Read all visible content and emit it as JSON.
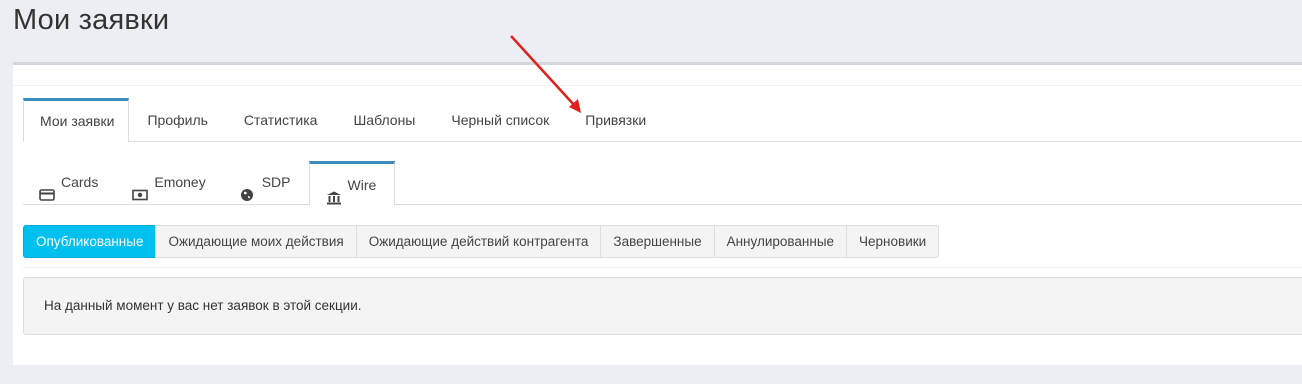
{
  "page": {
    "title": "Мои заявки"
  },
  "main_tabs": [
    {
      "label": "Мои заявки",
      "active": true
    },
    {
      "label": "Профиль",
      "active": false
    },
    {
      "label": "Статистика",
      "active": false
    },
    {
      "label": "Шаблоны",
      "active": false
    },
    {
      "label": "Черный список",
      "active": false
    },
    {
      "label": "Привязки",
      "active": false
    }
  ],
  "sub_tabs": [
    {
      "label": "Cards",
      "icon": "credit-card-icon",
      "active": false
    },
    {
      "label": "Emoney",
      "icon": "money-bill-icon",
      "active": false
    },
    {
      "label": "SDP",
      "icon": "globe-icon",
      "active": false
    },
    {
      "label": "Wire",
      "icon": "bank-icon",
      "active": true
    }
  ],
  "status_filters": [
    {
      "label": "Опубликованные",
      "active": true
    },
    {
      "label": "Ожидающие моих действия",
      "active": false
    },
    {
      "label": "Ожидающие действий контрагента",
      "active": false
    },
    {
      "label": "Завершенные",
      "active": false
    },
    {
      "label": "Аннулированные",
      "active": false
    },
    {
      "label": "Черновики",
      "active": false
    }
  ],
  "notice": {
    "text": "На данный момент у вас нет заявок в этой секции."
  },
  "colors": {
    "accent": "#3c8dbc",
    "active_button": "#00c0ef",
    "annotation_arrow": "#e0211b"
  }
}
